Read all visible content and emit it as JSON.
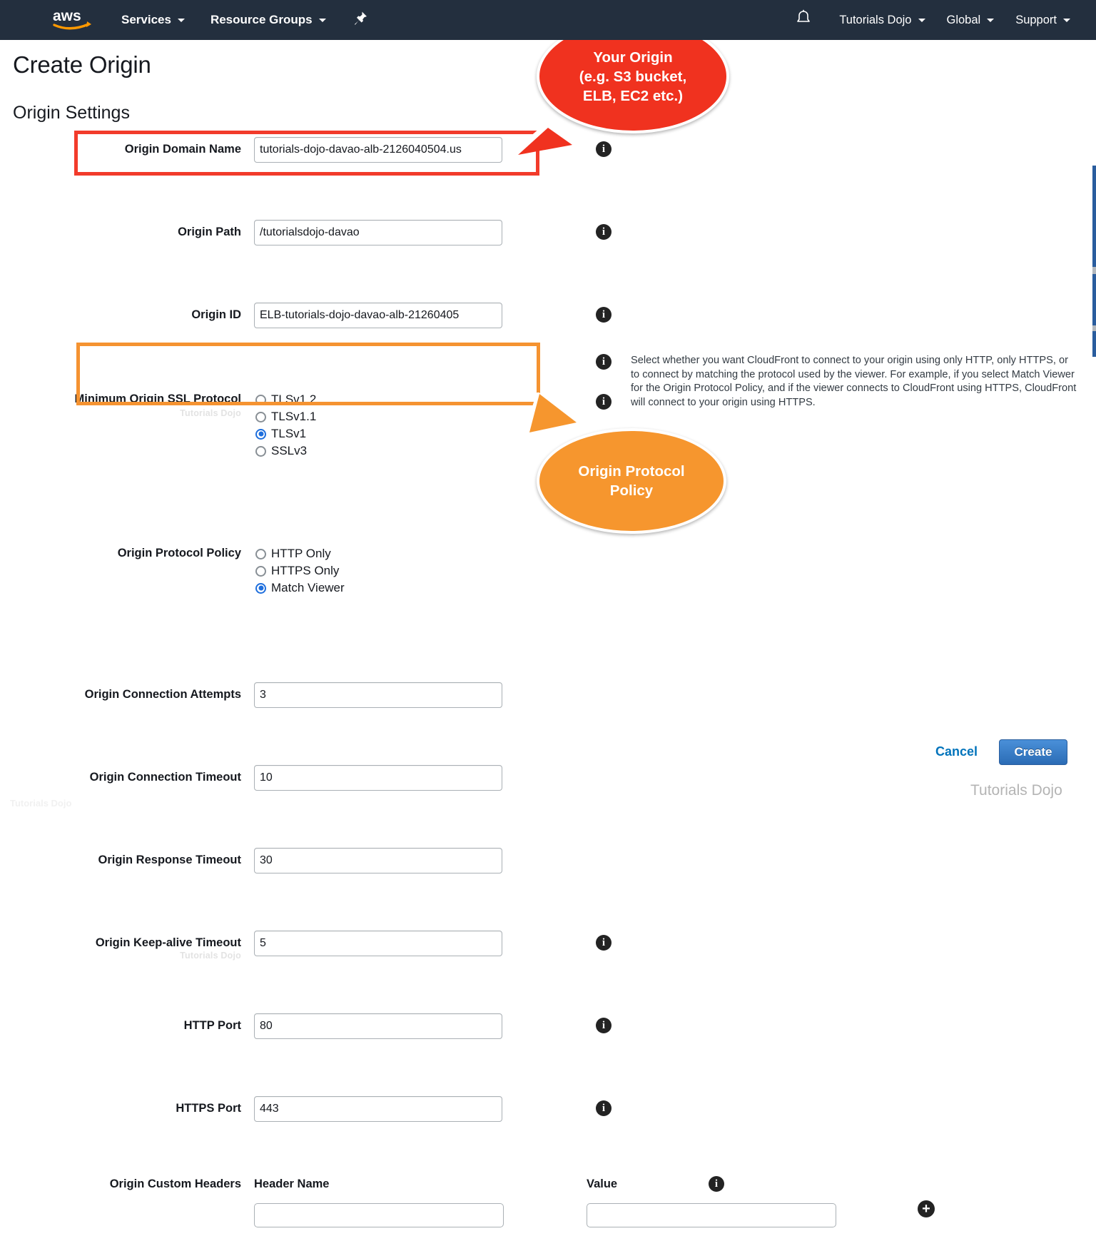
{
  "nav": {
    "logo_alt": "aws",
    "items": [
      {
        "label": "Services",
        "caret": true
      },
      {
        "label": "Resource Groups",
        "caret": true
      }
    ],
    "pin_icon": "pushpin-icon",
    "bell_icon": "bell-icon",
    "right_items": [
      {
        "label": "Tutorials Dojo",
        "caret": true
      },
      {
        "label": "Global",
        "caret": true
      },
      {
        "label": "Support",
        "caret": true
      }
    ]
  },
  "page": {
    "title": "Create Origin",
    "section_title": "Origin Settings"
  },
  "fields": {
    "origin_domain_name": {
      "label": "Origin Domain Name",
      "value": "tutorials-dojo-davao-alb-2126040504.us",
      "placeholder": ""
    },
    "origin_path": {
      "label": "Origin Path",
      "value": "/tutorialsdojo-davao",
      "placeholder": ""
    },
    "origin_id": {
      "label": "Origin ID",
      "value": "ELB-tutorials-dojo-davao-alb-21260405",
      "placeholder": ""
    },
    "min_ssl": {
      "label": "Minimum Origin SSL Protocol",
      "watermark": "Tutorials Dojo",
      "options": [
        "TLSv1.2",
        "TLSv1.1",
        "TLSv1",
        "SSLv3"
      ],
      "selected": "TLSv1"
    },
    "origin_protocol_policy": {
      "label": "Origin Protocol Policy",
      "options": [
        "HTTP Only",
        "HTTPS Only",
        "Match Viewer"
      ],
      "selected": "Match Viewer",
      "help": "Select whether you want CloudFront to connect to your origin using only HTTP, only HTTPS, or to connect by matching the protocol used by the viewer. For example, if you select Match Viewer for the Origin Protocol Policy, and if the viewer connects to CloudFront using HTTPS, CloudFront will connect to your origin using HTTPS."
    },
    "origin_connection_attempts": {
      "label": "Origin Connection Attempts",
      "value": "3"
    },
    "origin_connection_timeout": {
      "label": "Origin Connection Timeout",
      "value": "10"
    },
    "origin_response_timeout": {
      "label": "Origin Response Timeout",
      "value": "30"
    },
    "origin_keepalive_timeout": {
      "label": "Origin Keep-alive Timeout",
      "value": "5",
      "watermark": "Tutorials Dojo"
    },
    "http_port": {
      "label": "HTTP Port",
      "value": "80"
    },
    "https_port": {
      "label": "HTTPS Port",
      "value": "443"
    },
    "custom_headers": {
      "label": "Origin Custom Headers",
      "header_name_col": "Header Name",
      "value_col": "Value",
      "header_name_value": "",
      "value_value": "",
      "add_icon": "plus-icon"
    }
  },
  "footer": {
    "cancel_label": "Cancel",
    "create_label": "Create"
  },
  "callouts": {
    "red": {
      "line1": "Your Origin",
      "line2": "(e.g. S3 bucket,",
      "line3": "ELB, EC2 etc.)",
      "color": "#f0321f"
    },
    "orange": {
      "line1": "Origin Protocol",
      "line2": "Policy",
      "color": "#f6962e"
    }
  },
  "watermarks": {
    "bottom_right": "Tutorials Dojo",
    "bottom_left": "Tutorials Dojo"
  },
  "colors": {
    "nav_bg": "#232f3e",
    "aws_orange": "#ff9900",
    "accent_blue": "#0073bb",
    "highlight_red": "#f23b2b",
    "highlight_orange": "#f59331",
    "radio_selected": "#1f6fdd"
  }
}
